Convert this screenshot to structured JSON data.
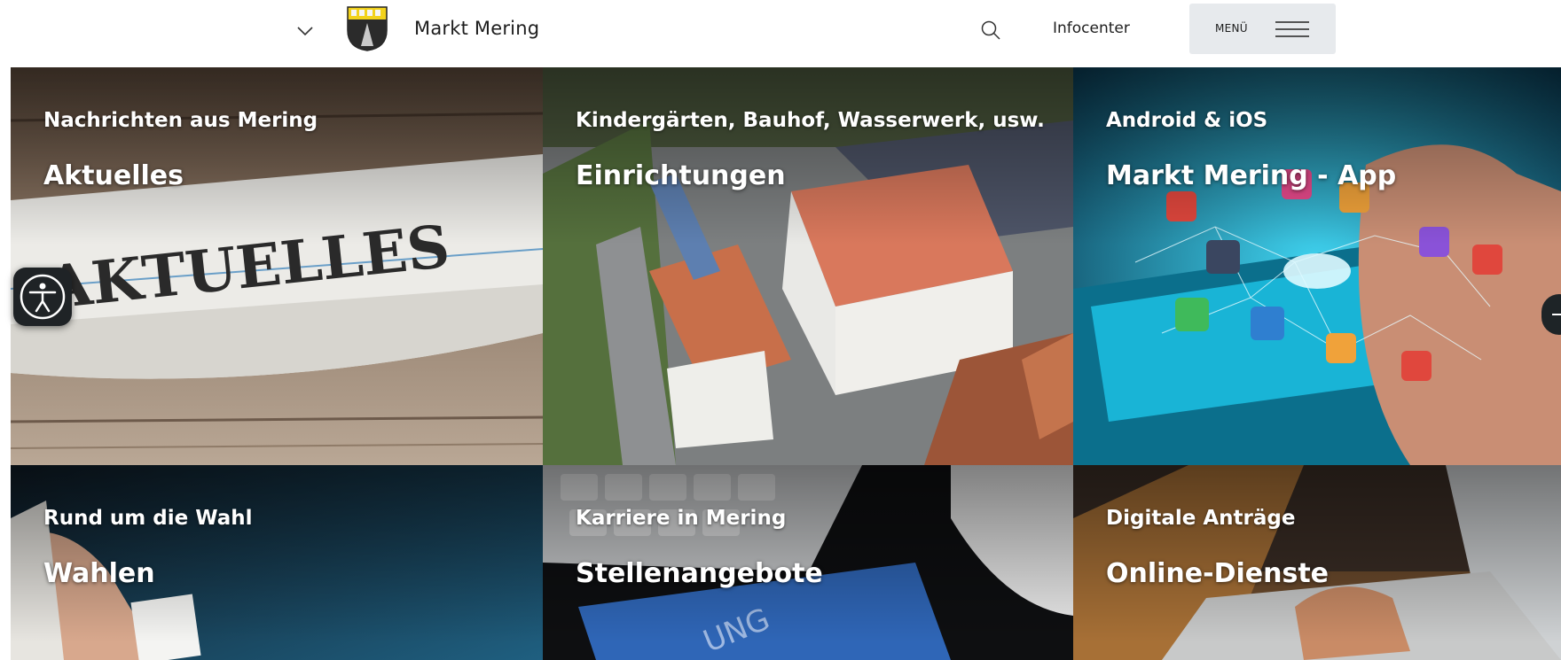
{
  "header": {
    "site_title": "Markt Mering",
    "infocenter_label": "Infocenter",
    "menu_label": "MENÜ",
    "icons": [
      "chevron-down-icon",
      "crest-logo",
      "search-icon",
      "hamburger-icon"
    ]
  },
  "tiles": [
    {
      "kicker": "Nachrichten aus Mering",
      "title": "Aktuelles",
      "image_text": "AKTUELLES"
    },
    {
      "kicker": "Kindergärten, Bauhof, Wasserwerk, usw.",
      "title": "Einrichtungen"
    },
    {
      "kicker": "Android & iOS",
      "title": "Markt Mering - App"
    },
    {
      "kicker": "Rund um die Wahl",
      "title": "Wahlen"
    },
    {
      "kicker": "Karriere in Mering",
      "title": "Stellenangebote",
      "image_text": "UNG"
    },
    {
      "kicker": "Digitale Anträge",
      "title": "Online-Dienste"
    }
  ],
  "widgets": {
    "accessibility_icon": "accessibility-icon",
    "slider_arrow_icon": "arrow-icon"
  },
  "colors": {
    "menu_bg": "#e7eaed",
    "text_dark": "#1d1d1d",
    "accessibility_bg": "#1f2326"
  }
}
